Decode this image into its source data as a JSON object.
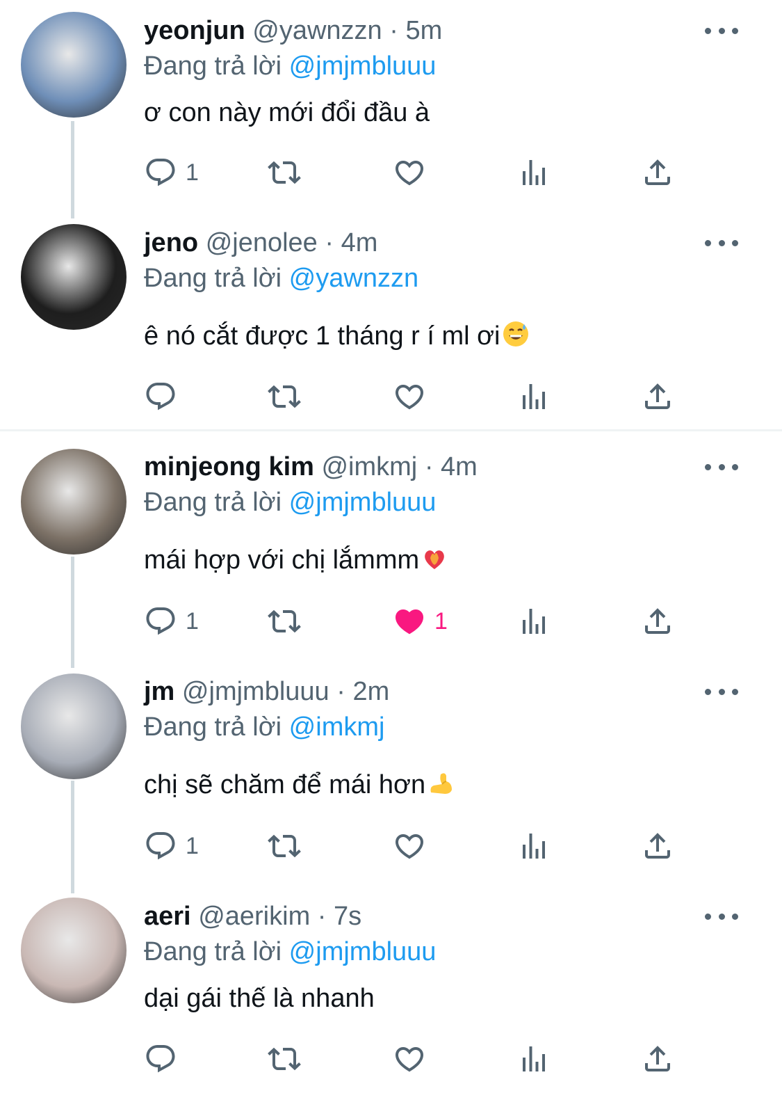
{
  "tweets": [
    {
      "name": "yeonjun",
      "handle": "@yawnzzn",
      "dot": "·",
      "time": "5m",
      "reply_prefix": "Đang trả lời",
      "reply_to": "@jmjmbluuu",
      "text": "ơ con này mới đổi đầu à",
      "reply_count": "1",
      "like_count": "",
      "liked": false,
      "avatar_color": "#6f8fb8"
    },
    {
      "name": "jeno",
      "handle": "@jenolee",
      "dot": "·",
      "time": "4m",
      "reply_prefix": "Đang trả lời",
      "reply_to": "@yawnzzn",
      "text": "ê nó cắt được 1 tháng r í ml ơi",
      "text_emoji": "grinning-sweat-emoji",
      "reply_count": "",
      "like_count": "",
      "liked": false,
      "avatar_color": "#1e1e1e"
    },
    {
      "name": "minjeong kim",
      "handle": "@imkmj",
      "dot": "·",
      "time": "4m",
      "reply_prefix": "Đang trả lời",
      "reply_to": "@jmjmbluuu",
      "text": "mái hợp với chị lắmmm",
      "text_emoji": "heart-on-fire-emoji",
      "reply_count": "1",
      "like_count": "1",
      "liked": true,
      "avatar_color": "#7d7267"
    },
    {
      "name": "jm",
      "handle": "@jmjmbluuu",
      "dot": "·",
      "time": "2m",
      "reply_prefix": "Đang trả lời",
      "reply_to": "@imkmj",
      "text": "chị sẽ chăm để mái hơn",
      "text_emoji": "flexed-biceps-emoji",
      "reply_count": "1",
      "like_count": "",
      "liked": false,
      "avatar_color": "#a8adb7"
    },
    {
      "name": "aeri",
      "handle": "@aerikim",
      "dot": "·",
      "time": "7s",
      "reply_prefix": "Đang trả lời",
      "reply_to": "@jmjmbluuu",
      "text": "dại gái thế là nhanh",
      "reply_count": "",
      "like_count": "",
      "liked": false,
      "avatar_color": "#c9b8b4"
    }
  ],
  "icons": {
    "more": "more-options-icon",
    "reply": "reply-icon",
    "retweet": "retweet-icon",
    "like": "like-icon",
    "views": "views-icon",
    "share": "share-icon"
  },
  "colors": {
    "mention": "#1d9bf0",
    "secondary": "#536471",
    "like_active": "#f91880",
    "thread_line": "#cfd9de"
  }
}
